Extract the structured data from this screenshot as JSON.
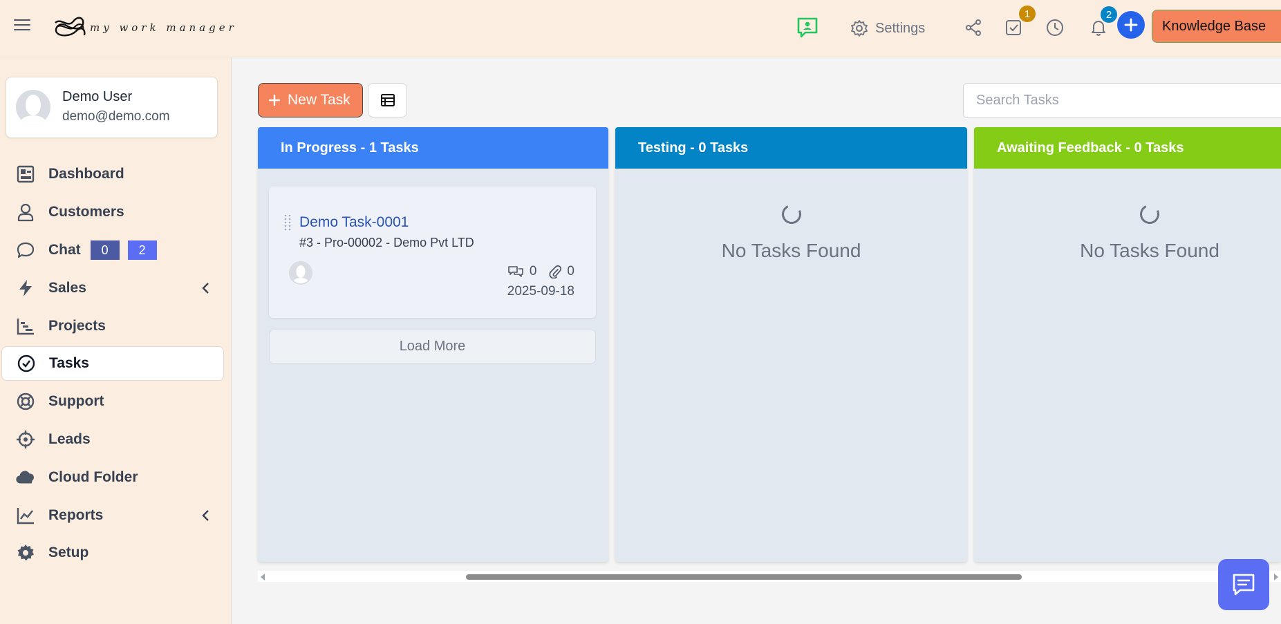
{
  "header": {
    "logo_text": "my work manager",
    "settings_label": "Settings",
    "tasks_badge": "1",
    "notifications_badge": "2",
    "knowledge_base_label": "Knowledge Base",
    "colors": {
      "bg": "#fbede0",
      "accent_orange": "#f5835b",
      "plus_blue": "#2563eb",
      "tasks_badge": "#ca8a04",
      "notif_badge": "#0284c7"
    }
  },
  "user": {
    "name": "Demo User",
    "email": "demo@demo.com"
  },
  "sidebar": {
    "items": [
      {
        "label": "Dashboard",
        "icon": "dashboard-icon"
      },
      {
        "label": "Customers",
        "icon": "user-icon"
      },
      {
        "label": "Chat",
        "icon": "chat-bubble-icon",
        "badges": [
          "0",
          "2"
        ]
      },
      {
        "label": "Sales",
        "icon": "bolt-icon",
        "has_submenu": true
      },
      {
        "label": "Projects",
        "icon": "gantt-icon"
      },
      {
        "label": "Tasks",
        "icon": "check-circle-icon",
        "active": true
      },
      {
        "label": "Support",
        "icon": "lifebuoy-icon"
      },
      {
        "label": "Leads",
        "icon": "crosshair-icon"
      },
      {
        "label": "Cloud Folder",
        "icon": "cloud-icon"
      },
      {
        "label": "Reports",
        "icon": "line-chart-icon",
        "has_submenu": true
      },
      {
        "label": "Setup",
        "icon": "gear-icon"
      }
    ]
  },
  "toolbar": {
    "new_task_label": "New Task",
    "search_placeholder": "Search Tasks"
  },
  "columns": [
    {
      "title": "In Progress - 1 Tasks",
      "color": "#3b82f6",
      "tasks": [
        {
          "title": "Demo Task-0001",
          "subtitle": "#3 - Pro-00002 - Demo Pvt LTD",
          "comments": "0",
          "attachments": "0",
          "date": "2025-09-18"
        }
      ],
      "load_more_label": "Load More"
    },
    {
      "title": "Testing - 0 Tasks",
      "color": "#0284c7",
      "empty_text": "No Tasks Found"
    },
    {
      "title": "Awaiting Feedback - 0 Tasks",
      "color": "#84cc16",
      "empty_text": "No Tasks Found"
    }
  ]
}
